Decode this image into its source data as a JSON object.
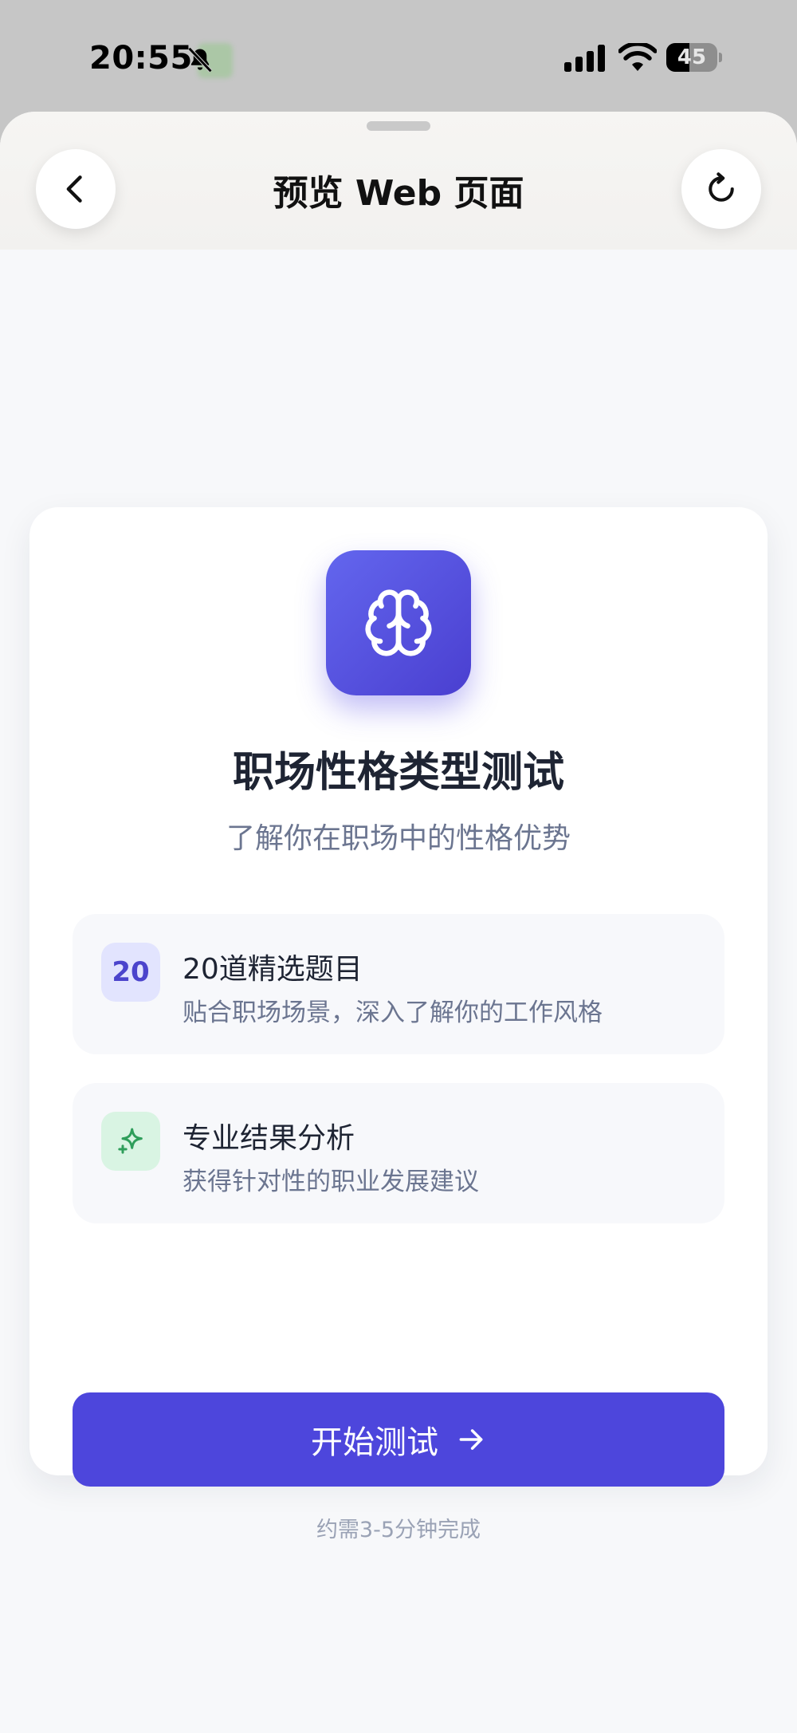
{
  "status_bar": {
    "time": "20:55",
    "battery_percent": "45",
    "battery_level": 0.45,
    "icons": [
      "bell-slash-icon",
      "cellular-signal-icon",
      "wifi-icon",
      "battery-icon"
    ]
  },
  "header": {
    "title": "预览 Web 页面",
    "back_icon": "chevron-left-icon",
    "reload_icon": "refresh-icon"
  },
  "card": {
    "icon": "brain-icon",
    "title": "职场性格类型测试",
    "subtitle": "了解你在职场中的性格优势",
    "features": [
      {
        "badge": "20",
        "title": "20道精选题目",
        "description": "贴合职场场景，深入了解你的工作风格"
      },
      {
        "badge_icon": "sparkle-icon",
        "title": "专业结果分析",
        "description": "获得针对性的职业发展建议"
      }
    ],
    "start_button": "开始测试",
    "start_button_icon": "arrow-right-icon",
    "duration_note": "约需3-5分钟完成"
  },
  "colors": {
    "accent": "#4d46dc",
    "icon_gradient_start": "#6366ee",
    "icon_gradient_end": "#4a3fd0",
    "badge_number_bg": "#e2e4fe",
    "badge_sparkle_bg": "#d9f4e3",
    "sparkle_green": "#2f9e5b",
    "page_bg": "#f7f8fa"
  }
}
